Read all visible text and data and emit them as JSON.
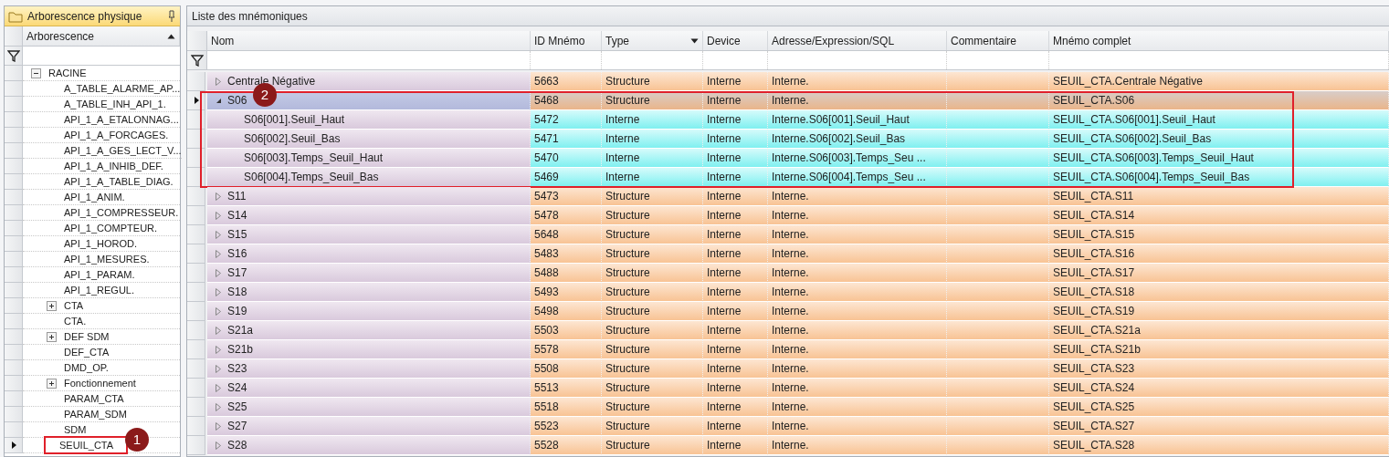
{
  "tree_panel": {
    "title": "Arborescence physique",
    "column": "Arborescence",
    "items": [
      {
        "label": "RACINE",
        "expanded": true,
        "selected": false,
        "children": [
          {
            "label": "A_TABLE_ALARME_AP...",
            "selected": false
          },
          {
            "label": "A_TABLE_INH_API_1.",
            "selected": false
          },
          {
            "label": "API_1_A_ETALONNAG...",
            "selected": false
          },
          {
            "label": "API_1_A_FORCAGES.",
            "selected": false
          },
          {
            "label": "API_1_A_GES_LECT_V...",
            "selected": false
          },
          {
            "label": "API_1_A_INHIB_DEF.",
            "selected": false
          },
          {
            "label": "API_1_A_TABLE_DIAG.",
            "selected": false
          },
          {
            "label": "API_1_ANIM.",
            "selected": false
          },
          {
            "label": "API_1_COMPRESSEUR.",
            "selected": false
          },
          {
            "label": "API_1_COMPTEUR.",
            "selected": false
          },
          {
            "label": "API_1_HOROD.",
            "selected": false
          },
          {
            "label": "API_1_MESURES.",
            "selected": false
          },
          {
            "label": "API_1_PARAM.",
            "selected": false
          },
          {
            "label": "API_1_REGUL.",
            "selected": false
          },
          {
            "label": "CTA",
            "expanded": false,
            "selected": false
          },
          {
            "label": "CTA.",
            "selected": false
          },
          {
            "label": "DEF SDM",
            "expanded": false,
            "selected": false
          },
          {
            "label": "DEF_CTA",
            "selected": false
          },
          {
            "label": "DMD_OP.",
            "selected": false
          },
          {
            "label": "Fonctionnement",
            "expanded": false,
            "selected": false
          },
          {
            "label": "PARAM_CTA",
            "selected": false
          },
          {
            "label": "PARAM_SDM",
            "selected": false
          },
          {
            "label": "SDM",
            "selected": false
          },
          {
            "label": "SEUIL_CTA",
            "selected": true,
            "callout": "1"
          }
        ]
      }
    ]
  },
  "grid_panel": {
    "title": "Liste des mnémoniques",
    "columns": [
      "Nom",
      "ID Mnémo",
      "Type",
      "Device",
      "Adresse/Expression/SQL",
      "Commentaire",
      "Mnémo complet"
    ],
    "rows": [
      {
        "kind": "structure",
        "name": "Centrale Négative",
        "expanded": false,
        "selected": false,
        "id": "5663",
        "type": "Structure",
        "device": "Interne",
        "address": "Interne.",
        "full": "SEUIL_CTA.Centrale Négative"
      },
      {
        "kind": "structure",
        "name": "S06",
        "expanded": true,
        "selected": true,
        "callout": "2",
        "id": "5468",
        "type": "Structure",
        "device": "Interne",
        "address": "Interne.",
        "full": "SEUIL_CTA.S06",
        "children": [
          {
            "kind": "member",
            "name": "S06[001].Seuil_Haut",
            "selected": false,
            "id": "5472",
            "type": "Interne",
            "device": "Interne",
            "address": "Interne.S06[001].Seuil_Haut",
            "full": "SEUIL_CTA.S06[001].Seuil_Haut"
          },
          {
            "kind": "member",
            "name": "S06[002].Seuil_Bas",
            "selected": false,
            "id": "5471",
            "type": "Interne",
            "device": "Interne",
            "address": "Interne.S06[002].Seuil_Bas",
            "full": "SEUIL_CTA.S06[002].Seuil_Bas"
          },
          {
            "kind": "member",
            "name": "S06[003].Temps_Seuil_Haut",
            "selected": false,
            "id": "5470",
            "type": "Interne",
            "device": "Interne",
            "address": "Interne.S06[003].Temps_Seu ...",
            "full": "SEUIL_CTA.S06[003].Temps_Seuil_Haut"
          },
          {
            "kind": "member",
            "name": "S06[004].Temps_Seuil_Bas",
            "selected": false,
            "id": "5469",
            "type": "Interne",
            "device": "Interne",
            "address": "Interne.S06[004].Temps_Seu ...",
            "full": "SEUIL_CTA.S06[004].Temps_Seuil_Bas"
          }
        ]
      },
      {
        "kind": "structure",
        "name": "S11",
        "expanded": false,
        "selected": false,
        "id": "5473",
        "type": "Structure",
        "device": "Interne",
        "address": "Interne.",
        "full": "SEUIL_CTA.S11"
      },
      {
        "kind": "structure",
        "name": "S14",
        "expanded": false,
        "selected": false,
        "id": "5478",
        "type": "Structure",
        "device": "Interne",
        "address": "Interne.",
        "full": "SEUIL_CTA.S14"
      },
      {
        "kind": "structure",
        "name": "S15",
        "expanded": false,
        "selected": false,
        "id": "5648",
        "type": "Structure",
        "device": "Interne",
        "address": "Interne.",
        "full": "SEUIL_CTA.S15"
      },
      {
        "kind": "structure",
        "name": "S16",
        "expanded": false,
        "selected": false,
        "id": "5483",
        "type": "Structure",
        "device": "Interne",
        "address": "Interne.",
        "full": "SEUIL_CTA.S16"
      },
      {
        "kind": "structure",
        "name": "S17",
        "expanded": false,
        "selected": false,
        "id": "5488",
        "type": "Structure",
        "device": "Interne",
        "address": "Interne.",
        "full": "SEUIL_CTA.S17"
      },
      {
        "kind": "structure",
        "name": "S18",
        "expanded": false,
        "selected": false,
        "id": "5493",
        "type": "Structure",
        "device": "Interne",
        "address": "Interne.",
        "full": "SEUIL_CTA.S18"
      },
      {
        "kind": "structure",
        "name": "S19",
        "expanded": false,
        "selected": false,
        "id": "5498",
        "type": "Structure",
        "device": "Interne",
        "address": "Interne.",
        "full": "SEUIL_CTA.S19"
      },
      {
        "kind": "structure",
        "name": "S21a",
        "expanded": false,
        "selected": false,
        "id": "5503",
        "type": "Structure",
        "device": "Interne",
        "address": "Interne.",
        "full": "SEUIL_CTA.S21a"
      },
      {
        "kind": "structure",
        "name": "S21b",
        "expanded": false,
        "selected": false,
        "id": "5578",
        "type": "Structure",
        "device": "Interne",
        "address": "Interne.",
        "full": "SEUIL_CTA.S21b"
      },
      {
        "kind": "structure",
        "name": "S23",
        "expanded": false,
        "selected": false,
        "id": "5508",
        "type": "Structure",
        "device": "Interne",
        "address": "Interne.",
        "full": "SEUIL_CTA.S23"
      },
      {
        "kind": "structure",
        "name": "S24",
        "expanded": false,
        "selected": false,
        "id": "5513",
        "type": "Structure",
        "device": "Interne",
        "address": "Interne.",
        "full": "SEUIL_CTA.S24"
      },
      {
        "kind": "structure",
        "name": "S25",
        "expanded": false,
        "selected": false,
        "id": "5518",
        "type": "Structure",
        "device": "Interne",
        "address": "Interne.",
        "full": "SEUIL_CTA.S25"
      },
      {
        "kind": "structure",
        "name": "S27",
        "expanded": false,
        "selected": false,
        "id": "5523",
        "type": "Structure",
        "device": "Interne",
        "address": "Interne.",
        "full": "SEUIL_CTA.S27"
      },
      {
        "kind": "structure",
        "name": "S28",
        "expanded": false,
        "selected": false,
        "id": "5528",
        "type": "Structure",
        "device": "Interne",
        "address": "Interne.",
        "full": "SEUIL_CTA.S28"
      }
    ]
  }
}
